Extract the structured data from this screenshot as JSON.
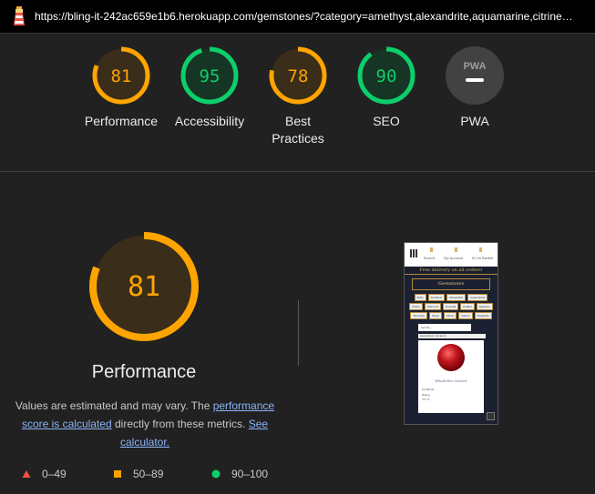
{
  "browser": {
    "url": "https://bling-it-242ac659e1b6.herokuapp.com/gemstones/?category=amethyst,alexandrite,aquamarine,citrine…"
  },
  "colors": {
    "average": "#ffa400",
    "pass": "#0cce6b",
    "fail": "#ff4e42",
    "pwa_bg": "#424242"
  },
  "gauges": [
    {
      "label": "Performance",
      "score": 81,
      "status": "average"
    },
    {
      "label": "Accessibility",
      "score": 95,
      "status": "pass"
    },
    {
      "label": "Best Practices",
      "score": 78,
      "status": "average"
    },
    {
      "label": "SEO",
      "score": 90,
      "status": "pass"
    },
    {
      "label": "PWA",
      "badge": "PWA",
      "status": "na"
    }
  ],
  "performance": {
    "score": 81,
    "title": "Performance",
    "note_prefix": "Values are estimated and may vary. The ",
    "note_link1": "performance score is calculated",
    "note_middle": " directly from these metrics. ",
    "note_link2": "See calculator."
  },
  "legend": [
    {
      "range": "0–49",
      "shape": "triangle",
      "color": "#ff4e42"
    },
    {
      "range": "50–89",
      "shape": "square",
      "color": "#ffa400"
    },
    {
      "range": "90–100",
      "shape": "circle",
      "color": "#0cce6b"
    }
  ],
  "thumbnail": {
    "nav": [
      "Search",
      "My Account",
      "£0.00 Basket"
    ],
    "banner": "Free delivery on all orders!",
    "heading": "Gemstones",
    "buttons": [
      "Ruby",
      "Amethyst",
      "Alexandrite",
      "Aquamarine",
      "Citrine",
      "Diamond",
      "Emerald",
      "Peridot",
      "Sapphire",
      "Tanzanite",
      "Topaz",
      "Zircon",
      "Garnet",
      "Morganite"
    ],
    "select": "Sort By...",
    "sort_label": "Gemstones: 14 items",
    "card_name": "Rhodolite Garnet",
    "card_lines": [
      "£1,500.00",
      "Rating",
      "4.5 / 5"
    ]
  }
}
